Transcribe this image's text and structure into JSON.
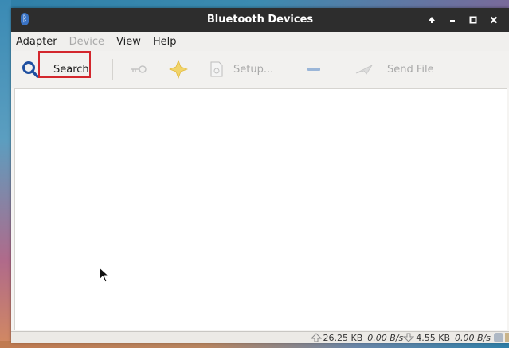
{
  "window": {
    "title": "Bluetooth Devices"
  },
  "menubar": {
    "items": [
      "Adapter",
      "Device",
      "View",
      "Help"
    ]
  },
  "toolbar": {
    "search_label": "Search",
    "setup_label": "Setup...",
    "send_file_label": "Send File"
  },
  "statusbar": {
    "upload_total": "26.25 KB",
    "upload_rate": "0.00 B/s",
    "download_total": "4.55 KB",
    "download_rate": "0.00 B/s"
  },
  "colors": {
    "highlight": "#d3272d",
    "titlebar": "#2d2d2d",
    "search_icon": "#1e4fa0"
  },
  "icons": [
    "bluetooth-icon",
    "search-icon",
    "key-icon",
    "star-icon",
    "document-icon",
    "minus-icon",
    "send-icon",
    "upload-arrow-icon",
    "download-arrow-icon",
    "status-indicator-icon"
  ]
}
